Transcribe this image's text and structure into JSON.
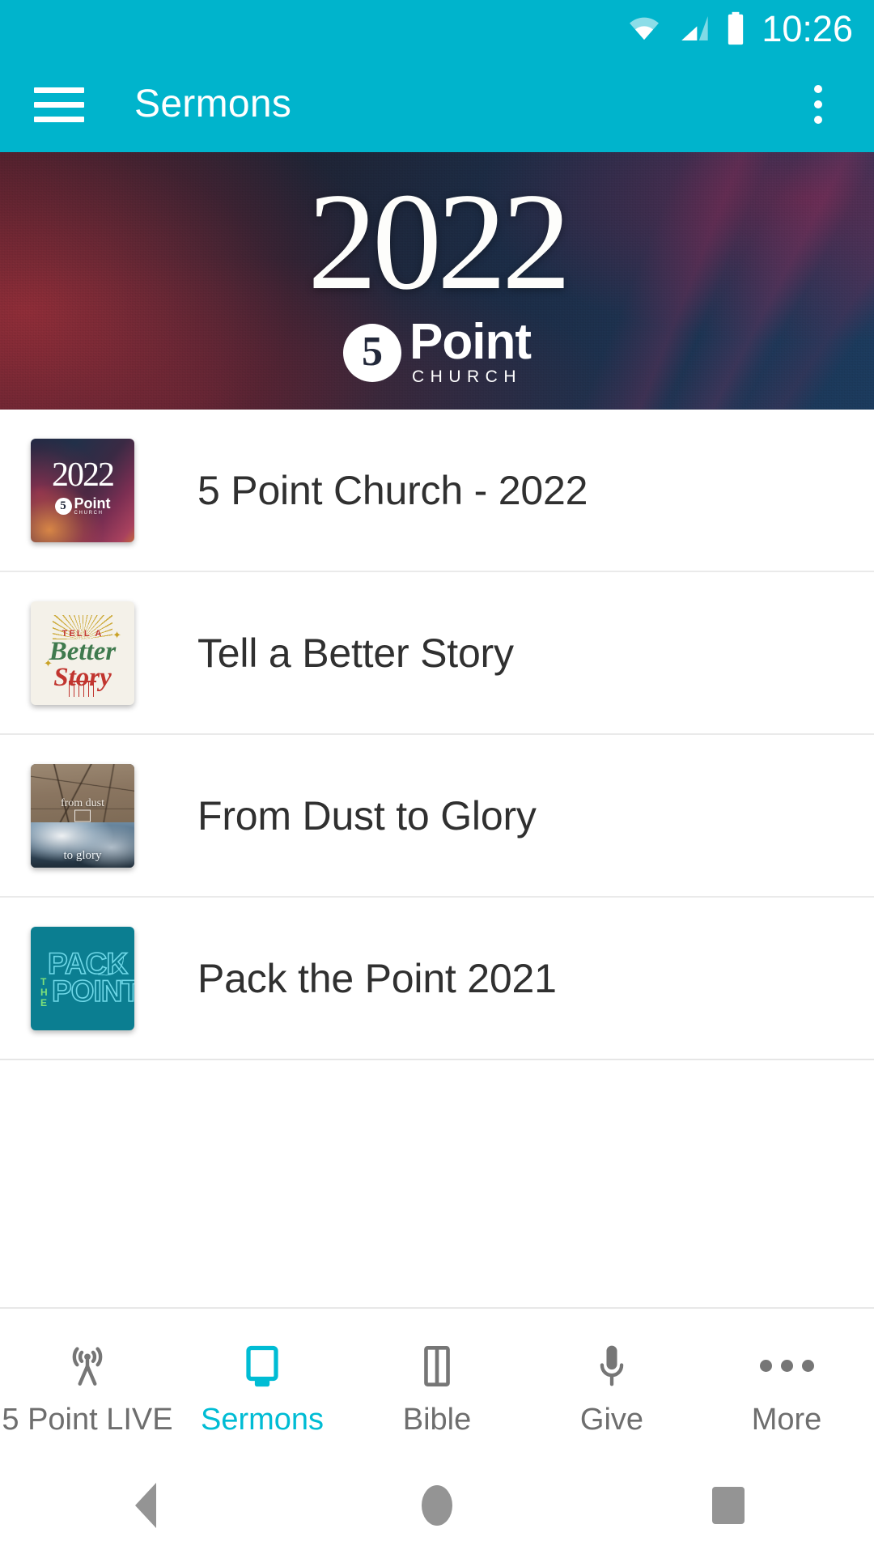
{
  "status_bar": {
    "clock": "10:26",
    "icons": [
      "wifi-icon",
      "cellular-signal-icon",
      "battery-icon"
    ],
    "background_color": "#00b4cc"
  },
  "app_bar": {
    "title": "Sermons",
    "menu_icon": "hamburger-menu-icon",
    "overflow_icon": "overflow-menu-icon",
    "background_color": "#00b4cc",
    "text_color": "#ffffff"
  },
  "hero": {
    "year": "2022",
    "logo": {
      "mark": "5",
      "name": "Point",
      "subtitle": "CHURCH"
    }
  },
  "sermon_list": {
    "items": [
      {
        "title": "5 Point Church - 2022",
        "thumbnail": "2022-series-artwork",
        "thumb_text": {
          "year": "2022",
          "logo_mark": "5",
          "logo_name": "Point",
          "logo_subtitle": "CHURCH"
        }
      },
      {
        "title": "Tell a Better Story",
        "thumbnail": "tell-a-better-story-artwork",
        "thumb_text": {
          "line1": "TELL A",
          "line2": "Better",
          "line3": "Story"
        },
        "colors": {
          "background": "#f4f1e9",
          "green": "#3f7a4e",
          "red": "#c1352f",
          "gold": "#c9a227"
        }
      },
      {
        "title": "From Dust to Glory",
        "thumbnail": "from-dust-to-glory-artwork",
        "thumb_text": {
          "top": "from dust",
          "bottom": "to glory"
        }
      },
      {
        "title": "Pack the Point 2021",
        "thumbnail": "pack-the-point-artwork",
        "thumb_text": {
          "word1": "PACK",
          "word2": "THE",
          "word3": "POINT"
        },
        "colors": {
          "background": "#0b7e91",
          "outline": "#6fd8e8",
          "accent": "#7ee07a"
        }
      }
    ]
  },
  "tab_bar": {
    "active_color": "#00bcd4",
    "inactive_color": "#6e6e6e",
    "tabs": [
      {
        "label": "5 Point LIVE",
        "icon": "broadcast-tower-icon",
        "active": false
      },
      {
        "label": "Sermons",
        "icon": "monitor-screen-icon",
        "active": true
      },
      {
        "label": "Bible",
        "icon": "open-book-icon",
        "active": false
      },
      {
        "label": "Give",
        "icon": "microphone-icon",
        "active": false
      },
      {
        "label": "More",
        "icon": "more-dots-icon",
        "active": false
      }
    ]
  },
  "android_nav": {
    "back": "back-triangle-icon",
    "home": "home-circle-icon",
    "recents": "recents-square-icon"
  }
}
